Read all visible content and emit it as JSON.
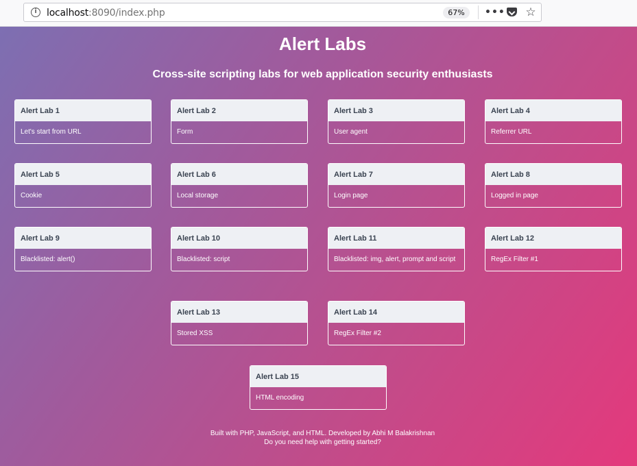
{
  "browser": {
    "url_host": "localhost",
    "url_rest": ":8090/index.php",
    "zoom": "67%",
    "more_icon": "•••",
    "star_icon": "☆"
  },
  "header": {
    "title": "Alert Labs",
    "subtitle": "Cross-site scripting labs for web application security enthusiasts"
  },
  "labs": [
    {
      "title": "Alert Lab 1",
      "desc": "Let's start from URL"
    },
    {
      "title": "Alert Lab 2",
      "desc": "Form"
    },
    {
      "title": "Alert Lab 3",
      "desc": "User agent"
    },
    {
      "title": "Alert Lab 4",
      "desc": "Referrer URL"
    },
    {
      "title": "Alert Lab 5",
      "desc": "Cookie"
    },
    {
      "title": "Alert Lab 6",
      "desc": "Local storage"
    },
    {
      "title": "Alert Lab 7",
      "desc": "Login page"
    },
    {
      "title": "Alert Lab 8",
      "desc": "Logged in page"
    },
    {
      "title": "Alert Lab 9",
      "desc": "Blacklisted: alert()"
    },
    {
      "title": "Alert Lab 10",
      "desc": "Blacklisted: script"
    },
    {
      "title": "Alert Lab 11",
      "desc": "Blacklisted: img, alert, prompt and script"
    },
    {
      "title": "Alert Lab 12",
      "desc": "RegEx Filter #1"
    },
    {
      "title": "Alert Lab 13",
      "desc": "Stored XSS"
    },
    {
      "title": "Alert Lab 14",
      "desc": "RegEx Filter #2"
    },
    {
      "title": "Alert Lab 15",
      "desc": "HTML encoding"
    }
  ],
  "footer": {
    "line1": "Built with PHP, JavaScript, and HTML. Developed by Abhi M Balakrishnan",
    "line2": "Do you need help with getting started?"
  }
}
